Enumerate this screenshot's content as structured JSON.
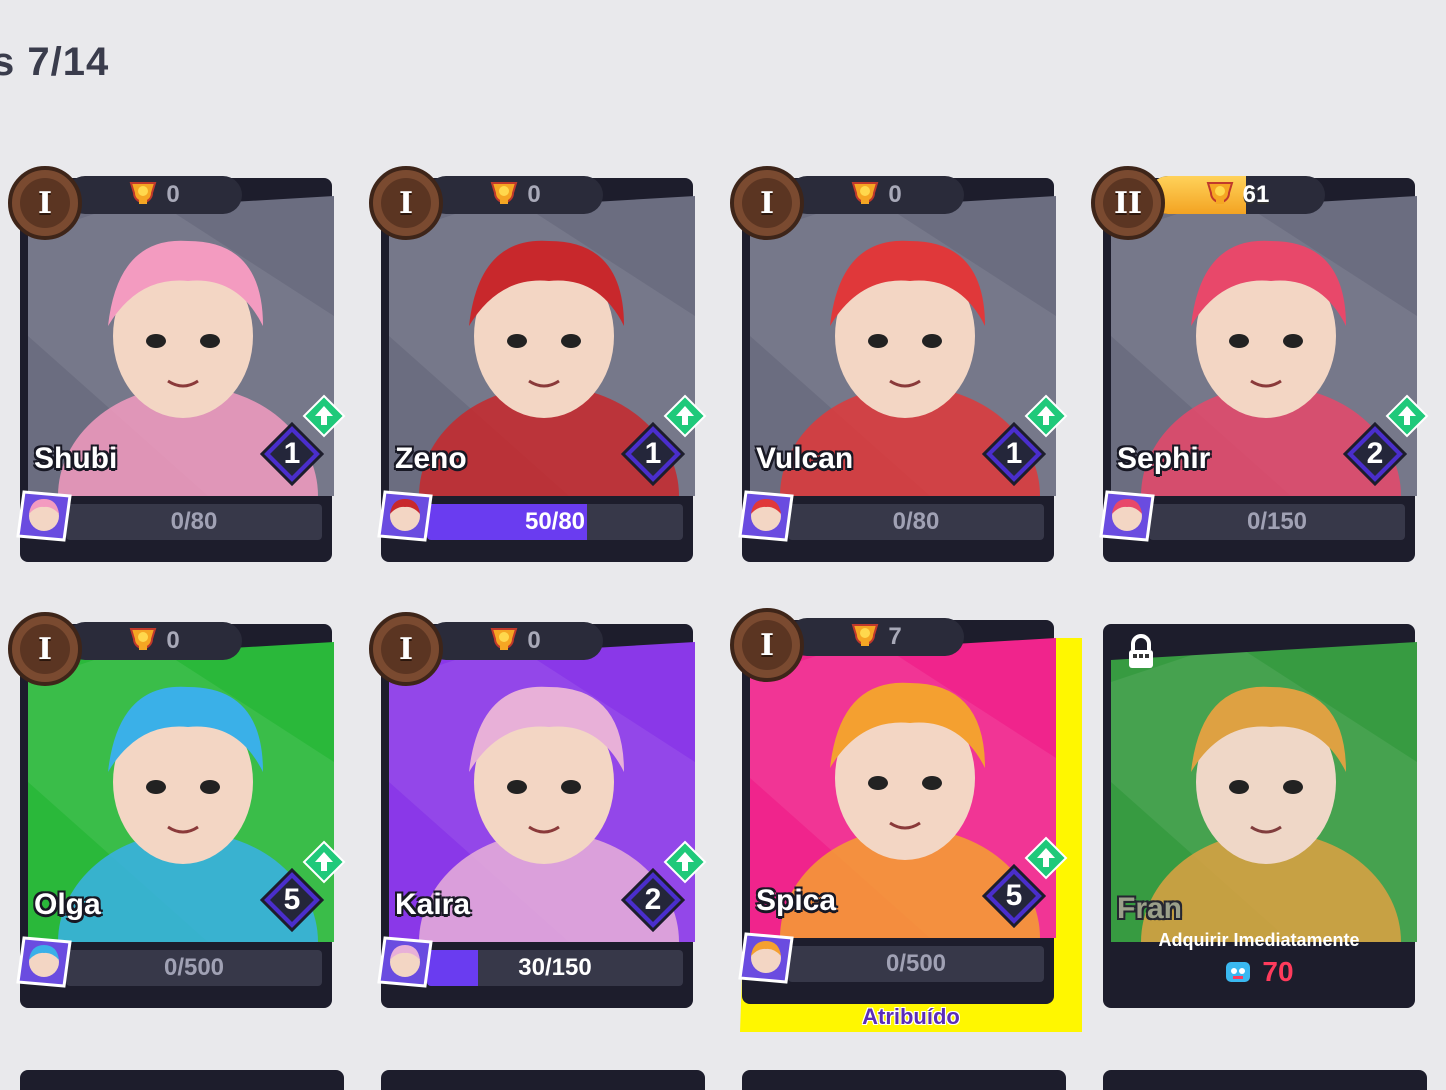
{
  "header": {
    "count_text": "s 7/14"
  },
  "colors": {
    "progress_fill": "#6a3cf0",
    "assigned_highlight": "#fff700",
    "price": "#ff3b5c",
    "trophy_fill": "#f3a322"
  },
  "cards": [
    {
      "name": "Shubi",
      "rank": "I",
      "trophies": "0",
      "level": "1",
      "progress": "0/80",
      "progress_fraction": 0,
      "bg": "#6b6d80",
      "accent": "#f39bc0"
    },
    {
      "name": "Zeno",
      "rank": "I",
      "trophies": "0",
      "level": "1",
      "progress": "50/80",
      "progress_fraction": 0.625,
      "bg": "#6b6d80",
      "accent": "#c8282c"
    },
    {
      "name": "Vulcan",
      "rank": "I",
      "trophies": "0",
      "level": "1",
      "progress": "0/80",
      "progress_fraction": 0,
      "bg": "#6b6d80",
      "accent": "#e0383a"
    },
    {
      "name": "Sephir",
      "rank": "II",
      "trophies": "61",
      "trophy_fraction": 0.55,
      "level": "2",
      "progress": "0/150",
      "progress_fraction": 0,
      "bg": "#6b6d80",
      "accent": "#e8486a"
    },
    {
      "name": "Olga",
      "rank": "I",
      "trophies": "0",
      "level": "5",
      "progress": "0/500",
      "progress_fraction": 0,
      "bg": "#2ab83a",
      "accent": "#3ab0e8"
    },
    {
      "name": "Kaira",
      "rank": "I",
      "trophies": "0",
      "level": "2",
      "progress": "30/150",
      "progress_fraction": 0.2,
      "bg": "#8a38e8",
      "accent": "#e8b0d8"
    },
    {
      "name": "Spica",
      "rank": "I",
      "trophies": "7",
      "level": "5",
      "progress": "0/500",
      "progress_fraction": 0,
      "bg": "#f0248c",
      "accent": "#f4a030",
      "assigned_label": "Atribuído"
    },
    {
      "name": "Fran",
      "locked": true,
      "buy_label": "Adquirir Imediatamente",
      "price": "70",
      "bg": "#2aa036",
      "accent": "#e8a030"
    }
  ]
}
